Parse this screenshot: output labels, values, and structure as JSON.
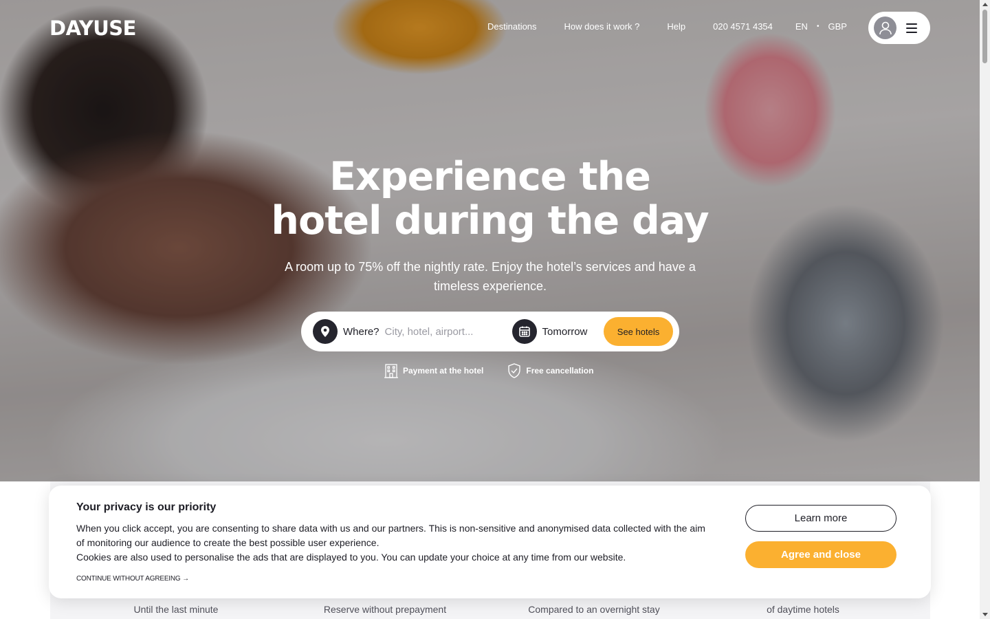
{
  "header": {
    "logo": "DAYUSE",
    "nav": {
      "destinations": "Destinations",
      "how": "How does it work ?",
      "help": "Help",
      "phone": "020 4571 4354",
      "language": "EN",
      "separator": "•",
      "currency": "GBP"
    },
    "icons": {
      "avatar": "user-icon",
      "menu": "hamburger-menu-icon"
    }
  },
  "hero": {
    "title_line1": "Experience the",
    "title_line2": "hotel during the day",
    "subtitle": "A room up to 75% off the nightly rate. Enjoy the hotel’s services and have a timeless experience."
  },
  "search": {
    "where_label": "Where?",
    "where_placeholder": "City, hotel, airport...",
    "where_value": "",
    "date_value": "Tomorrow",
    "submit_label": "See hotels",
    "icons": {
      "location": "map-pin-icon",
      "date": "calendar-icon"
    }
  },
  "perks": [
    {
      "label": "Payment at the hotel",
      "icon": "hotel-building-icon"
    },
    {
      "label": "Free cancellation",
      "icon": "shield-check-icon"
    }
  ],
  "features": [
    {
      "caption": "Until the last minute"
    },
    {
      "caption": "Reserve without prepayment"
    },
    {
      "caption": "Compared to an overnight stay"
    },
    {
      "caption": "of daytime hotels"
    }
  ],
  "cookie": {
    "title": "Your privacy is our priority",
    "body_line1": "When you click accept, you are consenting to share data with us and our partners. This is non-sensitive and anonymised data collected with the aim of monitoring our audience to create the best possible user experience.",
    "body_line2": "Cookies are also used to personalise the ads that are displayed to you. You can update your choice at any time from our website.",
    "continue_label": "CONTINUE WITHOUT AGREEING →",
    "learn_more_label": "Learn more",
    "agree_label": "Agree and close"
  },
  "colors": {
    "accent": "#fbb030",
    "dark": "#1d1d25",
    "icon_circle": "#25252e"
  }
}
